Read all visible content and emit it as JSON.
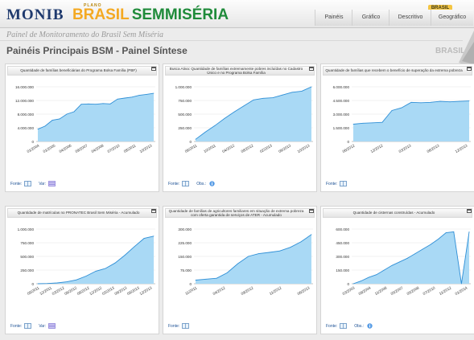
{
  "header": {
    "logo_monib": "MONIB",
    "logo_plano": "PLANO",
    "logo_brasil": "BRASIL",
    "logo_sem": "SEM",
    "logo_miseria": "MISÉRIA",
    "brasil_tab": "BRASIL",
    "nav": [
      "Painéis",
      "Gráfico",
      "Descritivo",
      "Geográfico"
    ],
    "subtitle": "Painel de Monitoramento do Brasil Sem Miséria"
  },
  "page": {
    "title": "Painéis Principais BSM - Painel Síntese",
    "region": "BRASIL"
  },
  "footer_labels": {
    "fonte": "Fonte:",
    "var": "Var:",
    "obs": "Obs.:"
  },
  "colors": {
    "line": "#2f8fd6",
    "fill": "#a9d9f5",
    "grid": "#e6e6e6",
    "title": "#1f3a6e",
    "brasil": "#f4a922",
    "green": "#1f8b3a"
  },
  "chart_data": [
    {
      "type": "area",
      "title": "Quantidade de famílias beneficiárias do Programa Bolsa Família (PBF)",
      "y_ticks": [
        "16.000.000",
        "12.000.000",
        "8.000.000",
        "4.000.000",
        "0"
      ],
      "ylim": [
        0,
        16000000
      ],
      "x_ticks": [
        "01/2004",
        "01/2005",
        "04/2006",
        "09/2007",
        "04/2008",
        "07/2010",
        "08/2011",
        "10/2013"
      ],
      "y_values": [
        3600000,
        4500000,
        6200000,
        6600000,
        8000000,
        8700000,
        10900000,
        11000000,
        10900000,
        11100000,
        11000000,
        12400000,
        12700000,
        13000000,
        13500000,
        13800000,
        14100000
      ],
      "footer": [
        "fonte",
        "var"
      ]
    },
    {
      "type": "area",
      "title": "Busca Ativa: Quantidade de famílias extremamente pobres incluídas no Cadastro Único e no Programa Bolsa Família",
      "y_ticks": [
        "1.000.000",
        "750.000",
        "500.000",
        "250.000",
        "0"
      ],
      "ylim": [
        0,
        1000000
      ],
      "x_ticks": [
        "06/2011",
        "10/2011",
        "04/2012",
        "08/2012",
        "02/2013",
        "06/2013",
        "10/2013"
      ],
      "y_values": [
        40000,
        170000,
        290000,
        420000,
        540000,
        650000,
        760000,
        790000,
        800000,
        850000,
        900000,
        920000,
        1000000
      ],
      "footer": [
        "fonte",
        "obs"
      ]
    },
    {
      "type": "area",
      "title": "Quantidade de famílias que recebem o benefício de superação da extrema pobreza",
      "y_ticks": [
        "6.000.000",
        "4.500.000",
        "3.000.000",
        "1.500.000",
        "0"
      ],
      "ylim": [
        0,
        6000000
      ],
      "x_ticks": [
        "06/2012",
        "12/2012",
        "03/2013",
        "06/2013",
        "12/2013"
      ],
      "y_values": [
        1900000,
        2000000,
        2050000,
        2100000,
        3400000,
        3700000,
        4300000,
        4250000,
        4300000,
        4400000,
        4350000,
        4400000,
        4450000
      ],
      "footer": [
        "fonte"
      ]
    },
    {
      "type": "area",
      "title": "Quantidade de matrículas no PRONATEC Brasil Sem Miséria - Acumulado",
      "y_ticks": [
        "1.000.000",
        "750.000",
        "500.000",
        "250.000",
        "0"
      ],
      "ylim": [
        0,
        1000000
      ],
      "x_ticks": [
        "09/2011",
        "12/2011",
        "03/2012",
        "06/2012",
        "09/2012",
        "12/2012",
        "03/2013",
        "06/2013",
        "09/2013",
        "12/2013"
      ],
      "y_values": [
        0,
        5000,
        15000,
        35000,
        70000,
        140000,
        230000,
        280000,
        380000,
        520000,
        680000,
        830000,
        870000
      ],
      "footer": [
        "fonte",
        "var"
      ]
    },
    {
      "type": "area",
      "title": "Quantidade de famílias de agricultores familiares em situação de extrema pobreza com oferta garantida de serviços de ATER - Acumulado",
      "y_ticks": [
        "300.000",
        "225.000",
        "150.000",
        "75.000",
        "0"
      ],
      "ylim": [
        0,
        300000
      ],
      "x_ticks": [
        "11/2011",
        "04/2012",
        "09/2012",
        "11/2012",
        "06/2013"
      ],
      "y_values": [
        20000,
        25000,
        30000,
        60000,
        110000,
        150000,
        165000,
        172000,
        180000,
        200000,
        230000,
        270000
      ],
      "footer": [
        "fonte"
      ]
    },
    {
      "type": "area",
      "title": "Quantidade de cisternas construídas - Acumulado",
      "y_ticks": [
        "600.000",
        "450.000",
        "300.000",
        "150.000",
        "0"
      ],
      "ylim": [
        0,
        600000
      ],
      "x_ticks": [
        "03/2003",
        "09/2004",
        "11/2006",
        "05/2007",
        "05/2008",
        "07/2010",
        "11/2012",
        "01/2014"
      ],
      "y_values": [
        0,
        30000,
        70000,
        100000,
        150000,
        200000,
        240000,
        280000,
        330000,
        380000,
        430000,
        490000,
        560000,
        570000,
        0,
        570000
      ],
      "footer": [
        "fonte",
        "obs"
      ]
    }
  ]
}
